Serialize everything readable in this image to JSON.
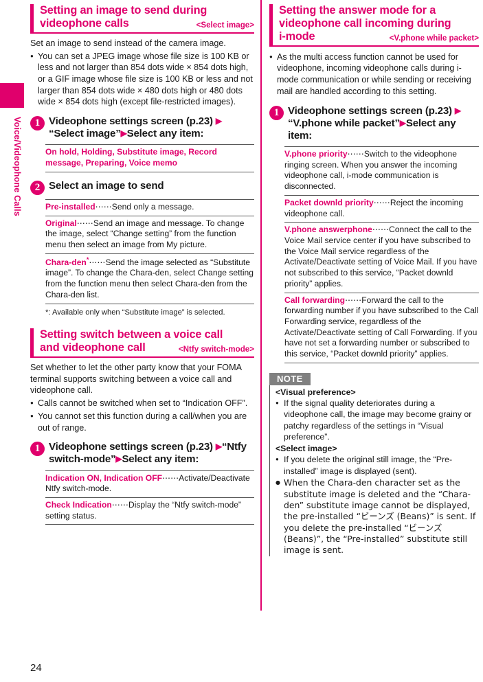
{
  "page": {
    "number": "24",
    "side_tab_label": "Voice/Videophone Calls"
  },
  "left_column": {
    "section1": {
      "title_line1": "Setting an image to send during",
      "title_line2": "videophone calls",
      "tag": "<Select image>",
      "intro": "Set an image to send instead of the camera image.",
      "bullet1": "You can set a JPEG image whose file size is 100 KB or less and not larger than 854 dots wide × 854 dots high, or a GIF image whose file size is 100 KB or less and not larger than 854 dots wide × 480 dots high or 480 dots wide × 854 dots high (except file-restricted images).",
      "step1": {
        "number": "1",
        "text_a": "Videophone settings screen (p.23)",
        "arrow": "▶",
        "text_b": "“Select image”",
        "text_c": "Select any item:"
      },
      "step1_options": [
        {
          "term": "On hold, Holding, Substitute image, Record message, Preparing, Voice memo",
          "desc": ""
        }
      ],
      "step2": {
        "number": "2",
        "text_a": "Select an image to send"
      },
      "step2_options": [
        {
          "term": "Pre-installed",
          "dots": "⋯⋯",
          "desc": "Send only a message."
        },
        {
          "term": "Original",
          "dots": "⋯⋯",
          "desc": "Send an image and message. To change the image, select “Change setting” from the function menu then select an image from My picture."
        },
        {
          "term": "Chara-den",
          "sup": "*",
          "dots": "⋯⋯",
          "desc": "Send the image selected as “Substitute image”.",
          "desc2": "To change the Chara-den, select Change setting from the function menu then select Chara-den from the Chara-den list."
        }
      ],
      "footnote": "*: Available only when “Substitute image” is selected."
    },
    "section2": {
      "title_line1": "Setting switch between a voice call",
      "title_line2": "and videophone call",
      "tag": "<Ntfy switch-mode>",
      "intro": "Set whether to let the other party know that your FOMA terminal supports switching between a voice call and videophone call.",
      "bullet1": "Calls cannot be switched when set to “Indication OFF”.",
      "bullet2": "You cannot set this function during a call/when you are out of range.",
      "step1": {
        "number": "1",
        "text_a": "Videophone settings screen (p.23)",
        "arrow": "▶",
        "text_b": "“Ntfy switch-mode”",
        "text_c": "Select any item:"
      },
      "step1_options": [
        {
          "term": "Indication ON, Indication OFF",
          "dots": "⋯⋯",
          "desc": "Activate/Deactivate Ntfy switch-mode."
        },
        {
          "term": "Check Indication",
          "dots": "⋯⋯",
          "desc": "Display the “Ntfy switch-mode” setting status."
        }
      ]
    }
  },
  "right_column": {
    "section1": {
      "title_line1": "Setting the answer mode for a",
      "title_line2": "videophone call incoming during",
      "title_line3": "i-mode",
      "tag": "<V.phone while packet>",
      "bullet1": "As the multi access function cannot be used for videophone, incoming videophone calls during i-mode communication or while sending or receiving mail are handled according to this setting.",
      "step1": {
        "number": "1",
        "text_a": "Videophone settings screen (p.23)",
        "arrow": "▶",
        "text_b": "“V.phone while packet”",
        "text_c": "Select any item:"
      },
      "step1_options": [
        {
          "term": "V.phone priority",
          "dots": "⋯⋯",
          "desc": "Switch to the videophone ringing screen. When you answer the incoming videophone call, i-mode communication is disconnected."
        },
        {
          "term": "Packet downld priority",
          "dots": "⋯⋯",
          "desc": "Reject the incoming videophone call."
        },
        {
          "term": "V.phone answerphone",
          "dots": "⋯⋯",
          "desc": "Connect the call to the Voice Mail service center if you have subscribed to the Voice Mail service regardless of the Activate/Deactivate setting of Voice Mail. If you have not subscribed to this service, “Packet downld priority” applies."
        },
        {
          "term": "Call forwarding",
          "dots": "⋯⋯",
          "desc": "Forward the call to the forwarding number if you have subscribed to the Call Forwarding service, regardless of the Activate/Deactivate setting of Call Forwarding. If you have not set a forwarding number or subscribed to this service, “Packet downld priority” applies."
        }
      ]
    },
    "note": {
      "badge": "NOTE",
      "group1_title": "<Visual preference>",
      "group1_bullets": [
        "If the signal quality deteriorates during a videophone call, the image may become grainy or patchy regardless of the settings in “Visual preference”."
      ],
      "group2_title": "<Select image>",
      "group2_bullets": [
        "If you delete the original still image, the “Pre-installed” image is displayed (sent).",
        "When the Chara-den character set as the substitute image is deleted and the “Chara-den” substitute image cannot be displayed, the pre-installed “ビーンズ (Beans)” is sent. If you delete the pre-installed “ビーンズ (Beans)”, the “Pre-installed” substitute still image is sent."
      ]
    }
  },
  "colors": {
    "accent_pink": "#e0006c",
    "note_gray": "#808080",
    "text": "#1a1a1a"
  }
}
